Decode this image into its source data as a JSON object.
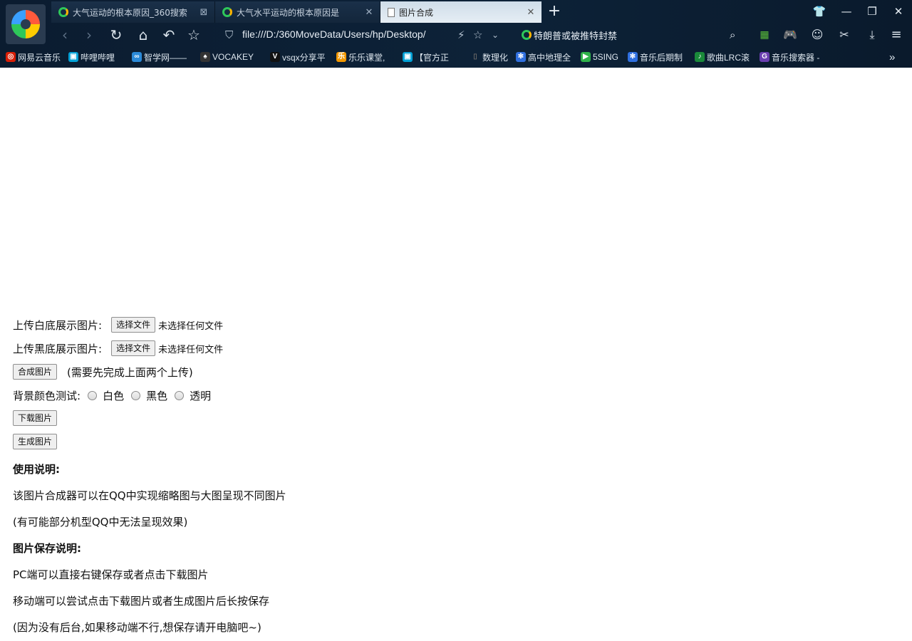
{
  "browser": {
    "tabs": [
      {
        "title": "大气运动的根本原因_360搜索",
        "close": "⊠"
      },
      {
        "title": "大气水平运动的根本原因是",
        "close": "✕"
      },
      {
        "title": "图片合成",
        "close": "✕"
      }
    ],
    "new_tab": "+",
    "window": {
      "skin": "👕",
      "minimize": "—",
      "restore": "❐",
      "close": "✕"
    },
    "url": "file:///D:/360MoveData/Users/hp/Desktop/",
    "hot_search": "特朗普或被推特封禁",
    "bookmarks": [
      {
        "label": "网易云音乐",
        "color": "#d81e06",
        "glyph": "◎"
      },
      {
        "label": "哔哩哔哩",
        "color": "#00a1d6",
        "glyph": "▣"
      },
      {
        "label": "智学网——",
        "color": "#2b8ad8",
        "glyph": "∞"
      },
      {
        "label": "VOCAKEY",
        "color": "#333333",
        "glyph": "♠"
      },
      {
        "label": "vsqx分享平",
        "color": "#111111",
        "glyph": "V"
      },
      {
        "label": "乐乐课堂,",
        "color": "#f39800",
        "glyph": "乐"
      },
      {
        "label": "【官方正",
        "color": "#00a1d6",
        "glyph": "▣"
      },
      {
        "label": "数理化",
        "color": "#ffffff",
        "glyph": "▯"
      },
      {
        "label": "高中地理全",
        "color": "#2f6fdf",
        "glyph": "✻"
      },
      {
        "label": "5SING",
        "color": "#2fb24a",
        "glyph": "▶"
      },
      {
        "label": "音乐后期制",
        "color": "#2f6fdf",
        "glyph": "✻"
      },
      {
        "label": "歌曲LRC滚",
        "color": "#1a8a3a",
        "glyph": "♪"
      },
      {
        "label": "音乐搜索器 -",
        "color": "#6a3fb0",
        "glyph": "G"
      }
    ],
    "more": "»"
  },
  "page": {
    "white_label": "上传白底展示图片:",
    "black_label": "上传黑底展示图片:",
    "choose_file": "选择文件",
    "no_file": "未选择任何文件",
    "compose_btn": "合成图片",
    "compose_hint": "(需要先完成上面两个上传)",
    "bg_label": "背景颜色测试:",
    "bg_options": [
      "白色",
      "黑色",
      "透明"
    ],
    "download_btn": "下载图片",
    "generate_btn": "生成图片",
    "usage_title": "使用说明:",
    "usage_1": "该图片合成器可以在QQ中实现缩略图与大图呈现不同图片",
    "usage_2": "(有可能部分机型QQ中无法呈现效果)",
    "save_title": "图片保存说明:",
    "save_1": "PC端可以直接右键保存或者点击下载图片",
    "save_2": "移动端可以尝试点击下载图片或者生成图片后长按保存",
    "save_3": "(因为没有后台,如果移动端不行,想保存请开电脑吧~)"
  }
}
